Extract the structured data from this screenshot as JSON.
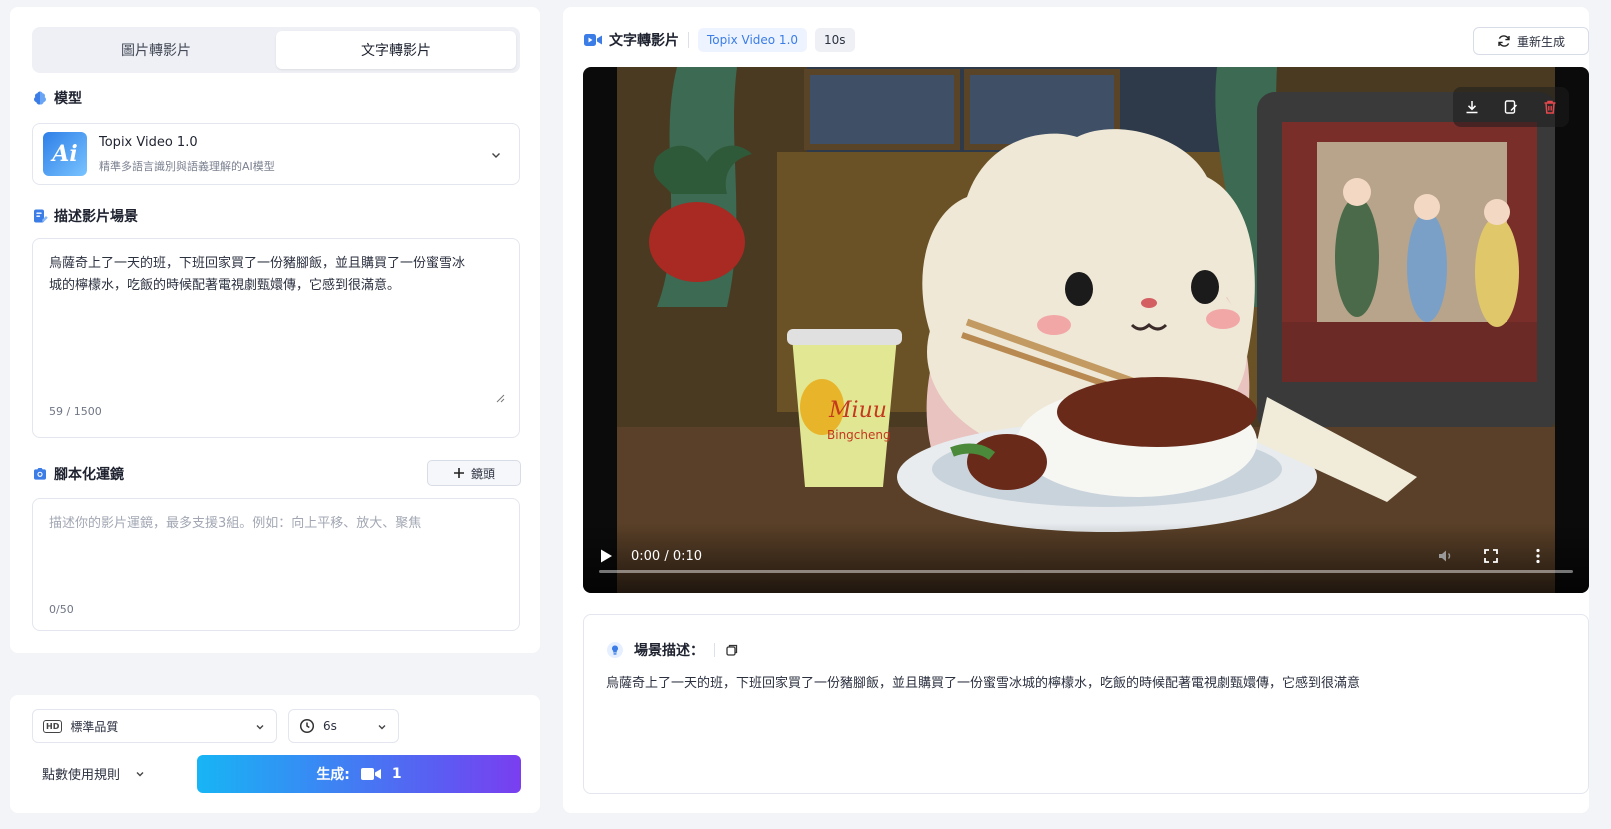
{
  "tabs": [
    {
      "label": "圖片轉影片",
      "active": false
    },
    {
      "label": "文字轉影片",
      "active": true
    }
  ],
  "model_section": {
    "title": "模型",
    "logo_text": "Ai",
    "selected_name": "Topix Video 1.0",
    "selected_desc": "精準多語言識別與語義理解的AI模型"
  },
  "scene_section": {
    "title": "描述影片場景",
    "text": "烏薩奇上了一天的班，下班回家買了一份豬腳飯，並且購買了一份蜜雪冰城的檸檬水，吃飯的時候配著電視劇甄嬛傳，它感到很滿意。",
    "line1": "烏薩奇上了一天的班，下班回家買了一份豬腳飯，並且購買了一份蜜雪冰",
    "line2": "城的檸檬水，吃飯的時候配著電視劇甄嬛傳，它感到很滿意。",
    "counter": "59 / 1500"
  },
  "camera_section": {
    "title": "腳本化運鏡",
    "add_button": "鏡頭",
    "placeholder": "描述你的影片運鏡，最多支援3組。例如：向上平移、放大、聚焦",
    "counter": "0/50"
  },
  "bottom": {
    "quality_icon": "HD",
    "quality": "標準品質",
    "duration": "6s",
    "rules": "點數使用規則",
    "generate_label": "生成:",
    "generate_cost": "1"
  },
  "result": {
    "title": "文字轉影片",
    "model_badge": "Topix Video 1.0",
    "duration_badge": "10s",
    "regenerate": "重新生成"
  },
  "video": {
    "time": "0:00 / 0:10",
    "progress": 0,
    "cup_text_1": "Miuu",
    "cup_text_2": "Bingcheng"
  },
  "description": {
    "title": "場景描述：",
    "text": "烏薩奇上了一天的班，下班回家買了一份豬腳飯，並且購買了一份蜜雪冰城的檸檬水，吃飯的時候配著電視劇甄嬛傳，它感到很滿意"
  },
  "colors": {
    "accent_blue": "#3b7ce6",
    "gradient_start": "#17b5f5",
    "gradient_end": "#7a3ef0",
    "delete_red": "#e5484d"
  }
}
